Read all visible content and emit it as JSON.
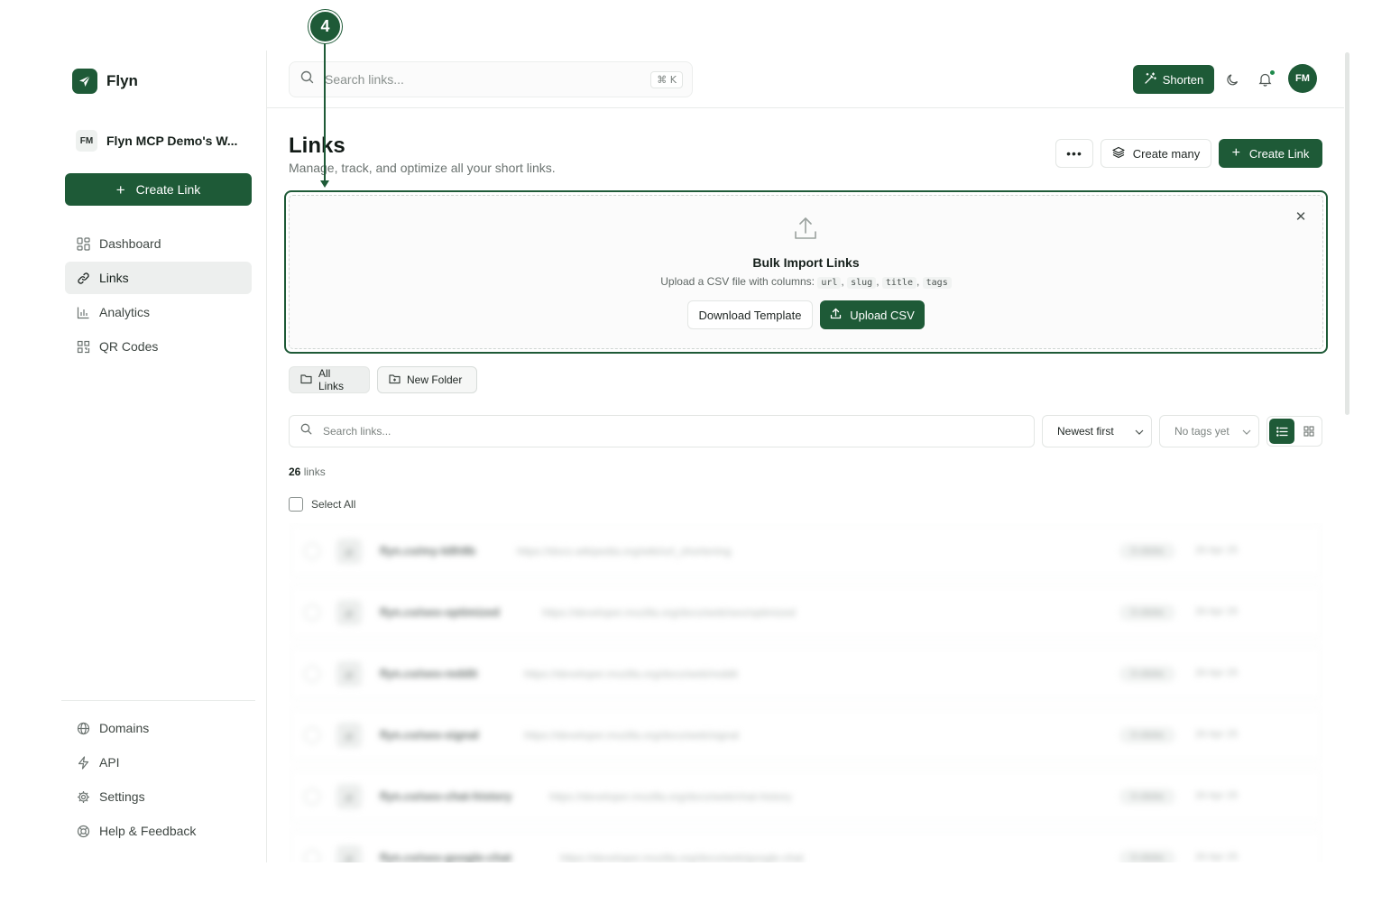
{
  "annotation": {
    "step": "4"
  },
  "sidebar": {
    "brand": "Flyn",
    "workspace": {
      "initials": "FM",
      "name": "Flyn MCP Demo's W..."
    },
    "create_link": "Create Link",
    "nav": [
      {
        "label": "Dashboard",
        "icon": "dashboard-icon"
      },
      {
        "label": "Links",
        "icon": "link-icon",
        "active": true
      },
      {
        "label": "Analytics",
        "icon": "analytics-icon"
      },
      {
        "label": "QR Codes",
        "icon": "qr-code-icon"
      }
    ],
    "nav_bottom": [
      {
        "label": "Domains",
        "icon": "globe-icon"
      },
      {
        "label": "API",
        "icon": "bolt-icon"
      },
      {
        "label": "Settings",
        "icon": "gear-icon"
      },
      {
        "label": "Help & Feedback",
        "icon": "lifebuoy-icon"
      }
    ]
  },
  "topbar": {
    "search_placeholder": "Search links...",
    "shortcut": "⌘ K",
    "shorten": "Shorten",
    "user_initials": "FM"
  },
  "page": {
    "title": "Links",
    "subtitle": "Manage, track, and optimize all your short links.",
    "more": "•••",
    "create_many": "Create many",
    "create_link": "Create Link"
  },
  "bulk": {
    "title": "Bulk Import Links",
    "desc_prefix": "Upload a CSV file with columns:",
    "columns": [
      "url",
      "slug",
      "title",
      "tags"
    ],
    "download_template": "Download Template",
    "upload_csv": "Upload CSV"
  },
  "folders": {
    "all": "All Links",
    "new": "New Folder"
  },
  "filters": {
    "search_placeholder": "Search links...",
    "sort": "Newest first",
    "tags": "No tags yet"
  },
  "list": {
    "count": "26",
    "count_label": "links",
    "select_all": "Select All",
    "rows": [
      {
        "slug": "flyn.co/my-k8h9b",
        "url": "https://docs.wikipedia.org/wiki/url_shortening",
        "clicks": "0 clicks",
        "date": "26 Apr 25"
      },
      {
        "slug": "flyn.co/seo-optimized",
        "url": "https://developer.mozilla.org/docs/web/seo/optimized",
        "clicks": "0 clicks",
        "date": "26 Apr 25"
      },
      {
        "slug": "flyn.co/seo-reddit",
        "url": "https://developer.mozilla.org/docs/web/reddit",
        "clicks": "0 clicks",
        "date": "26 Apr 25"
      },
      {
        "slug": "flyn.co/seo-signal",
        "url": "https://developer.mozilla.org/docs/web/signal",
        "clicks": "0 clicks",
        "date": "26 Apr 25"
      },
      {
        "slug": "flyn.co/seo-chat-history",
        "url": "https://developer.mozilla.org/docs/web/chat-history",
        "clicks": "0 clicks",
        "date": "26 Apr 25"
      },
      {
        "slug": "flyn.co/seo-google-chat",
        "url": "https://developer.mozilla.org/docs/web/google-chat",
        "clicks": "0 clicks",
        "date": "26 Apr 25"
      }
    ]
  },
  "colors": {
    "brand": "#1e5a37",
    "border": "#e3e6e4",
    "muted": "#6b7370"
  }
}
